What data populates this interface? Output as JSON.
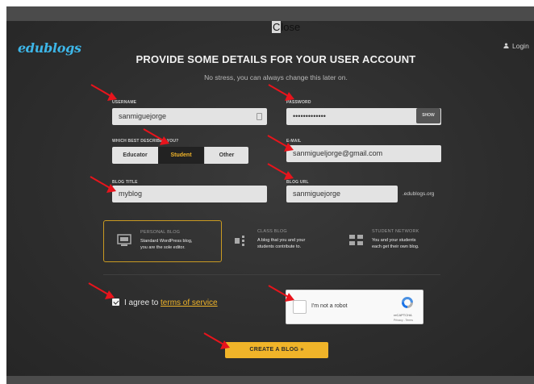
{
  "modal": {
    "close_label_first": "C",
    "close_label_rest": "lose"
  },
  "header": {
    "logo": "edublogs",
    "login": "Login"
  },
  "heading": "PROVIDE SOME DETAILS FOR YOUR USER ACCOUNT",
  "subheading": "No stress, you can always change this later on.",
  "fields": {
    "username": {
      "label": "USERNAME",
      "value": "sanmiguejorge"
    },
    "password": {
      "label": "PASSWORD",
      "value": "•••••••••••••",
      "show_label": "SHOW"
    },
    "role": {
      "label": "WHICH BEST DESCRIBES YOU?",
      "options": [
        "Educator",
        "Student",
        "Other"
      ],
      "selected": "Student"
    },
    "email": {
      "label": "E-MAIL",
      "value": "sanmigueljorge@gmail.com"
    },
    "blog_title": {
      "label": "BLOG TITLE",
      "value": "myblog"
    },
    "blog_url": {
      "label": "BLOG URL",
      "value": "sanmiguejorge",
      "suffix": ".edublogs.org"
    }
  },
  "plans": [
    {
      "title": "PERSONAL BLOG",
      "line1": "Standard WordPress blog,",
      "line2": "you are the sole editor.",
      "selected": true
    },
    {
      "title": "CLASS BLOG",
      "line1": "A blog that you and your",
      "line2": "students contribute to.",
      "selected": false
    },
    {
      "title": "STUDENT NETWORK",
      "line1": "You and your students",
      "line2": "each get their own blog.",
      "selected": false
    }
  ],
  "terms": {
    "prefix": "I agree to ",
    "link": "terms of service",
    "checked": true
  },
  "captcha": {
    "text": "I'm not a robot",
    "brand": "reCAPTCHA",
    "links": "Privacy - Terms"
  },
  "submit": {
    "label": "CREATE A BLOG »"
  },
  "colors": {
    "accent": "#f0b429",
    "logo": "#3db6e8",
    "annotation_arrow": "#e8141c",
    "background": "#2d2d2d"
  }
}
